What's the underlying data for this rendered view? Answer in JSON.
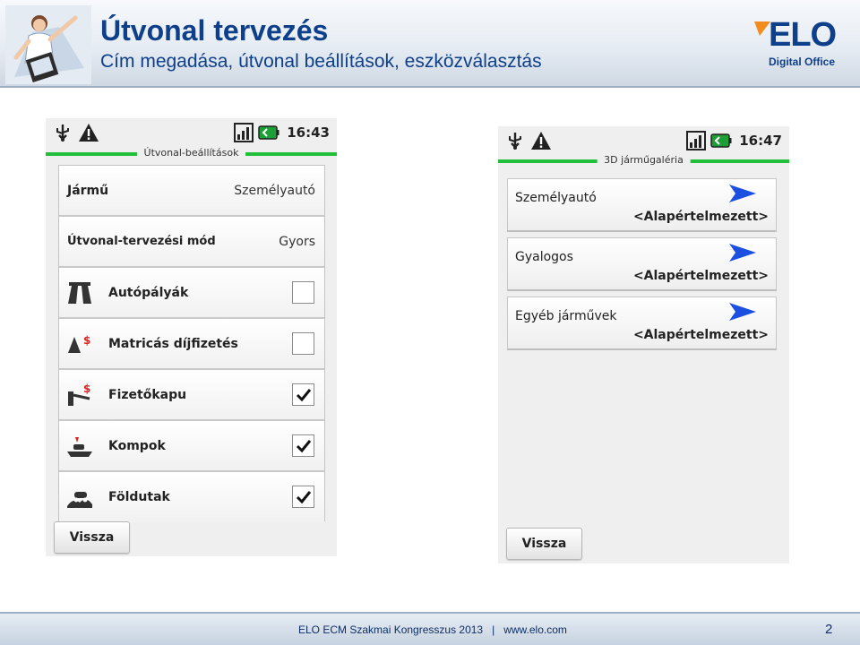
{
  "slide": {
    "title": "Útvonal tervezés",
    "subtitle": "Cím megadása, útvonal beállítások, eszközválasztás"
  },
  "logo": {
    "text": "ELO",
    "subtext": "Digital Office"
  },
  "left_screen": {
    "time": "16:43",
    "title": "Útvonal-beállítások",
    "rows": [
      {
        "label": "Jármű",
        "value": "Személyautó"
      },
      {
        "label": "Útvonal-tervezési mód",
        "value": "Gyors"
      },
      {
        "label": "Autópályák",
        "icon": "highway-icon",
        "checked": false
      },
      {
        "label": "Matricás díjfizetés",
        "icon": "toll-sticker-icon",
        "checked": false
      },
      {
        "label": "Fizetőkapu",
        "icon": "toll-gate-icon",
        "checked": true
      },
      {
        "label": "Kompok",
        "icon": "ferry-icon",
        "checked": true
      },
      {
        "label": "Földutak",
        "icon": "dirt-road-icon",
        "checked": true
      }
    ],
    "back_label": "Vissza"
  },
  "right_screen": {
    "time": "16:47",
    "title": "3D járműgaléria",
    "items": [
      {
        "name": "Személyautó",
        "value": "<Alapértelmezett>"
      },
      {
        "name": "Gyalogos",
        "value": "<Alapértelmezett>"
      },
      {
        "name": "Egyéb járművek",
        "value": "<Alapértelmezett>"
      }
    ],
    "back_label": "Vissza"
  },
  "footer": {
    "text": "ELO ECM Szakmai Kongresszus 2013   |   www.elo.com",
    "page": "2"
  },
  "colors": {
    "brand_blue": "#0d3f8a",
    "title_line_green": "#1fbf3a",
    "logo_orange": "#f28c1e",
    "arrow_blue": "#1a4fe0"
  }
}
